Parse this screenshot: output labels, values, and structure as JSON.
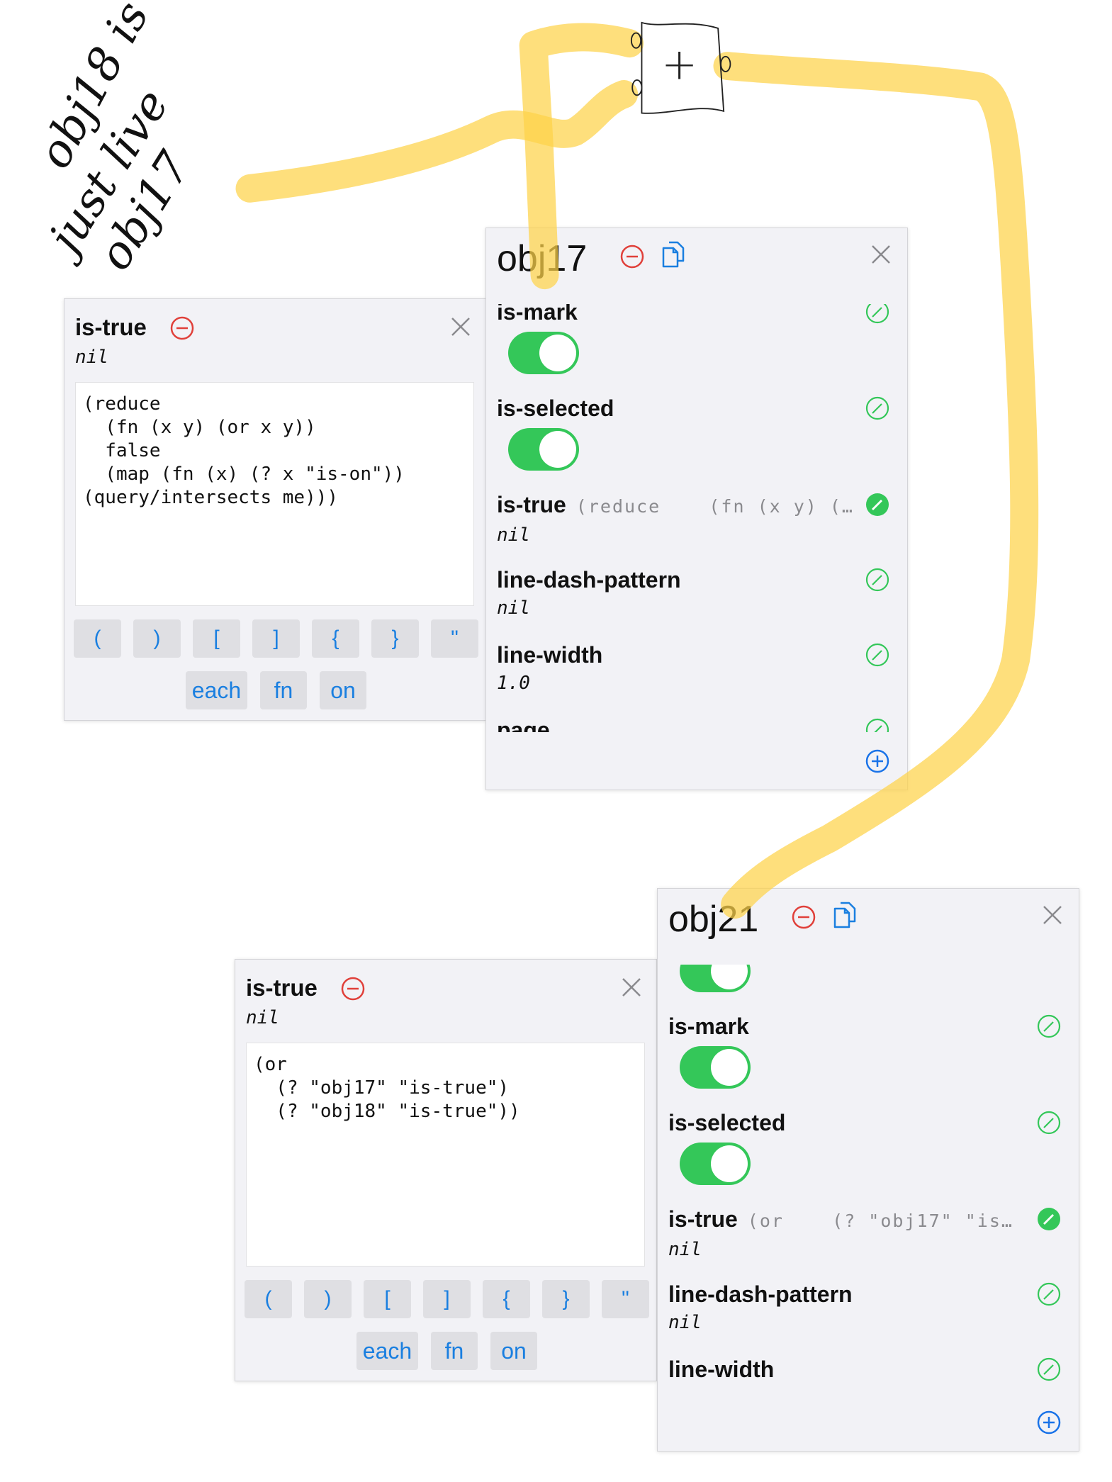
{
  "colors": {
    "toggle_on": "#34c759",
    "delete": "#e0403a",
    "accent": "#1a7fe0",
    "highlighter": "#fdd85d"
  },
  "handwriting": {
    "line1": "obj18 is",
    "line2": "just live",
    "line3": "obj17"
  },
  "sketch": {
    "box_symbol": "+"
  },
  "editor_top": {
    "title": "is-true",
    "value": "nil",
    "code": "(reduce\n  (fn (x y) (or x y))\n  false\n  (map (fn (x) (? x \"is-on\"))\n(query/intersects me)))",
    "bracket_keys": [
      "(",
      ")",
      "[",
      "]",
      "{",
      "}",
      "\""
    ],
    "word_keys": [
      "each",
      "fn",
      "on"
    ]
  },
  "editor_bottom": {
    "title": "is-true",
    "value": "nil",
    "code": "(or\n  (? \"obj17\" \"is-true\")\n  (? \"obj18\" \"is-true\"))",
    "bracket_keys": [
      "(",
      ")",
      "[",
      "]",
      "{",
      "}",
      "\""
    ],
    "word_keys": [
      "each",
      "fn",
      "on"
    ]
  },
  "obj17": {
    "title": "obj17",
    "props": [
      {
        "name": "is-mark",
        "toggle": true
      },
      {
        "name": "is-selected",
        "toggle": true
      },
      {
        "name": "is-true",
        "preview": "(reduce    (fn (x y) (…",
        "value": "nil"
      },
      {
        "name": "line-dash-pattern",
        "value": "nil"
      },
      {
        "name": "line-width",
        "value": "1.0"
      },
      {
        "name": "page"
      }
    ]
  },
  "obj21": {
    "title": "obj21",
    "props": [
      {
        "toggle": true
      },
      {
        "name": "is-mark",
        "toggle": true
      },
      {
        "name": "is-selected",
        "toggle": true
      },
      {
        "name": "is-true",
        "preview": "(or    (? \"obj17\" \"is…",
        "value": "nil"
      },
      {
        "name": "line-dash-pattern",
        "value": "nil"
      },
      {
        "name": "line-width"
      }
    ]
  }
}
